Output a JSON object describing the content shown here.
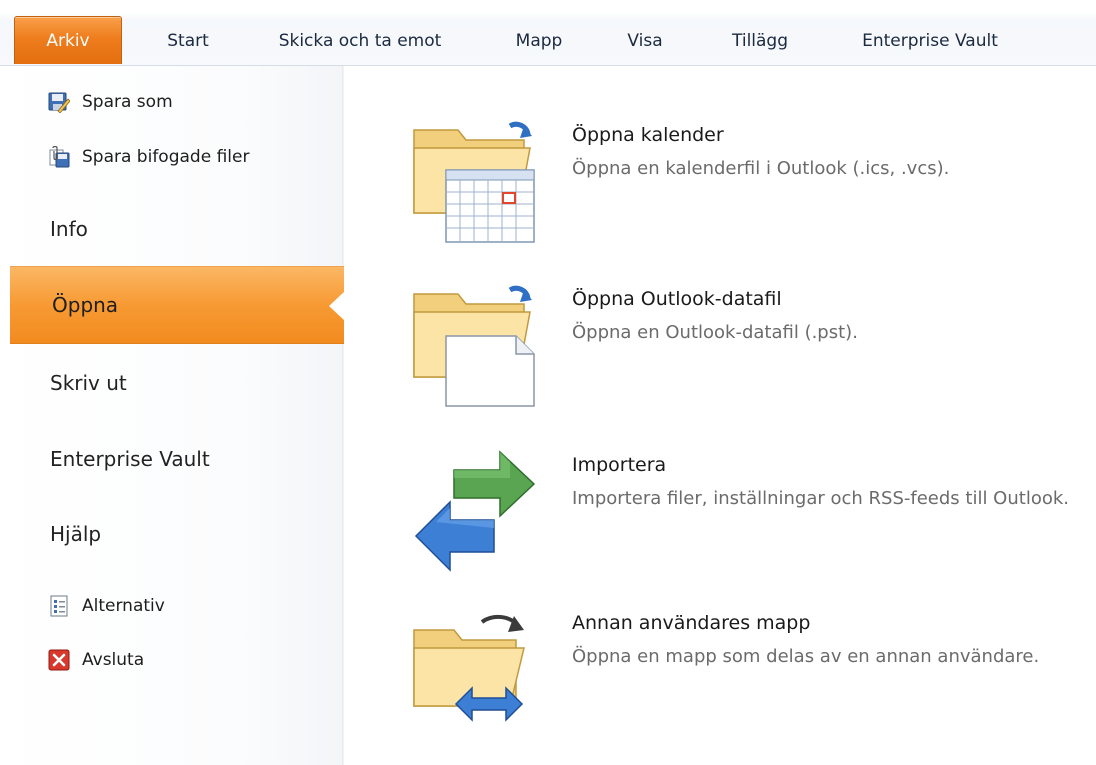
{
  "ribbon": {
    "tabs": [
      "Arkiv",
      "Start",
      "Skicka och ta emot",
      "Mapp",
      "Visa",
      "Tillägg",
      "Enterprise Vault"
    ]
  },
  "nav": {
    "commands_top": [
      {
        "label": "Spara som",
        "icon": "save-as-icon"
      },
      {
        "label": "Spara bifogade filer",
        "icon": "save-attachments-icon"
      }
    ],
    "items": [
      "Info",
      "Öppna",
      "Skriv ut",
      "Enterprise Vault",
      "Hjälp"
    ],
    "active_item": "Öppna",
    "commands_bottom": [
      {
        "label": "Alternativ",
        "icon": "options-icon"
      },
      {
        "label": "Avsluta",
        "icon": "exit-icon"
      }
    ]
  },
  "content": {
    "options": [
      {
        "title": "Öppna kalender",
        "desc": "Öppna en kalenderfil i Outlook (.ics, .vcs).",
        "icon": "open-calendar-icon"
      },
      {
        "title": "Öppna Outlook-datafil",
        "desc": "Öppna en Outlook-datafil (.pst).",
        "icon": "open-datafile-icon"
      },
      {
        "title": "Importera",
        "desc": "Importera filer, inställningar och RSS-feeds till Outlook.",
        "icon": "import-arrows-icon"
      },
      {
        "title": "Annan användares mapp",
        "desc": "Öppna en mapp som delas av en annan användare.",
        "icon": "other-user-folder-icon"
      }
    ]
  },
  "colors": {
    "file_tab": "#ee7d1d",
    "active_nav": "#f79a33",
    "description_text": "#6b6b6b"
  }
}
